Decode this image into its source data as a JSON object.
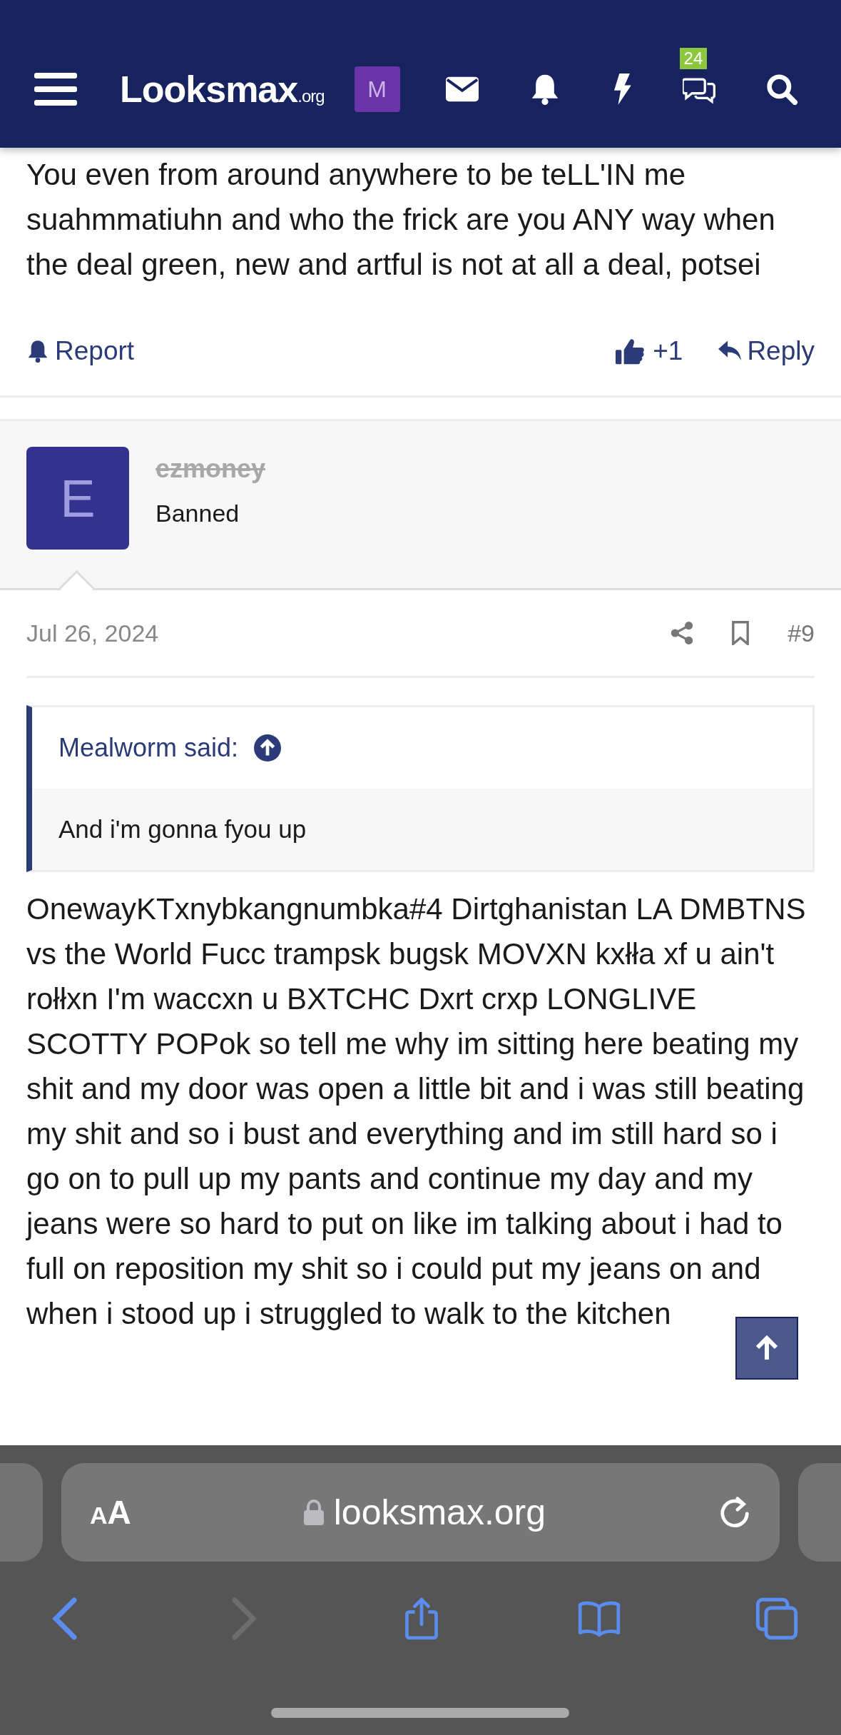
{
  "header": {
    "logo": "Looksmax",
    "logo_suffix": ".org",
    "account_initial": "M",
    "chat_badge": "24"
  },
  "previous_post": {
    "text": "You even from around anywhere to be teLL'IN me suahmmatiuhn and who the frick are you ANY way when the deal green, new and artful is not at all a deal, potsei",
    "report": "Report",
    "likes": "+1",
    "reply": "Reply"
  },
  "post": {
    "avatar_initial": "E",
    "username": "ezmoney",
    "banned": true,
    "user_title": "Banned",
    "date": "Jul 26, 2024",
    "number": "#9",
    "quote": {
      "author": "Mealworm said:",
      "text": "And i'm gonna fyou up"
    },
    "text": "OnewayKTxnybkangnumbka#4 Dirtghanistan LA DMBTNS vs the World Fucc trampsk bugsk MOVXN kxłła xf u ain't rołłxn I'm waccxn u BXTCHC Dxrt crxp LONGLIVE SCOTTY POPok so tell me why im sitting here beating my shit and my door was open a little bit and i was still beating my shit and so i bust and everything and im still hard so i go on to pull up my pants and continue my day and my jeans were so hard to put on like im talking about i had to full on reposition my shit so i could put my jeans on and when i stood up i struggled to walk to the kitchen"
  },
  "browser": {
    "reader_button": "AA",
    "url": "looksmax.org",
    "can_go_forward": false
  }
}
